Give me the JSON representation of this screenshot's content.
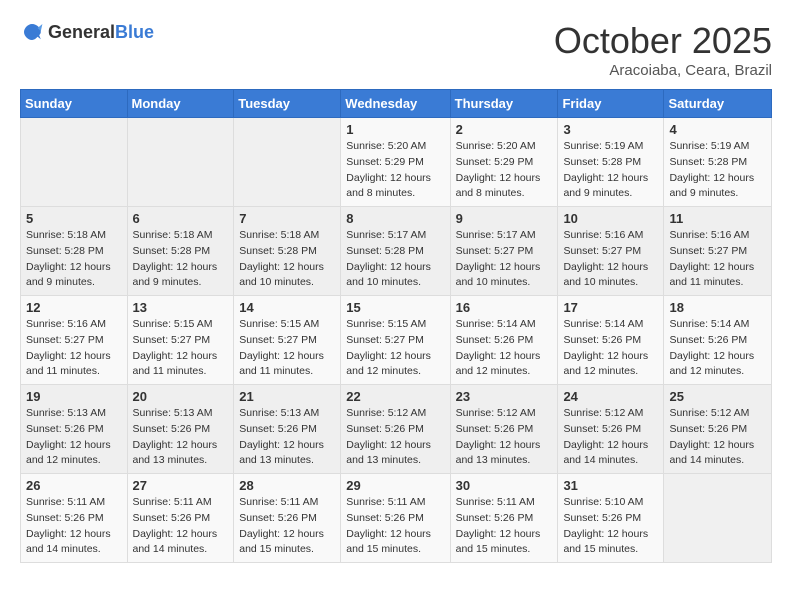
{
  "header": {
    "logo_general": "General",
    "logo_blue": "Blue",
    "month": "October 2025",
    "location": "Aracoiaba, Ceara, Brazil"
  },
  "weekdays": [
    "Sunday",
    "Monday",
    "Tuesday",
    "Wednesday",
    "Thursday",
    "Friday",
    "Saturday"
  ],
  "weeks": [
    [
      {
        "day": "",
        "sunrise": "",
        "sunset": "",
        "daylight": ""
      },
      {
        "day": "",
        "sunrise": "",
        "sunset": "",
        "daylight": ""
      },
      {
        "day": "",
        "sunrise": "",
        "sunset": "",
        "daylight": ""
      },
      {
        "day": "1",
        "sunrise": "Sunrise: 5:20 AM",
        "sunset": "Sunset: 5:29 PM",
        "daylight": "Daylight: 12 hours and 8 minutes."
      },
      {
        "day": "2",
        "sunrise": "Sunrise: 5:20 AM",
        "sunset": "Sunset: 5:29 PM",
        "daylight": "Daylight: 12 hours and 8 minutes."
      },
      {
        "day": "3",
        "sunrise": "Sunrise: 5:19 AM",
        "sunset": "Sunset: 5:28 PM",
        "daylight": "Daylight: 12 hours and 9 minutes."
      },
      {
        "day": "4",
        "sunrise": "Sunrise: 5:19 AM",
        "sunset": "Sunset: 5:28 PM",
        "daylight": "Daylight: 12 hours and 9 minutes."
      }
    ],
    [
      {
        "day": "5",
        "sunrise": "Sunrise: 5:18 AM",
        "sunset": "Sunset: 5:28 PM",
        "daylight": "Daylight: 12 hours and 9 minutes."
      },
      {
        "day": "6",
        "sunrise": "Sunrise: 5:18 AM",
        "sunset": "Sunset: 5:28 PM",
        "daylight": "Daylight: 12 hours and 9 minutes."
      },
      {
        "day": "7",
        "sunrise": "Sunrise: 5:18 AM",
        "sunset": "Sunset: 5:28 PM",
        "daylight": "Daylight: 12 hours and 10 minutes."
      },
      {
        "day": "8",
        "sunrise": "Sunrise: 5:17 AM",
        "sunset": "Sunset: 5:28 PM",
        "daylight": "Daylight: 12 hours and 10 minutes."
      },
      {
        "day": "9",
        "sunrise": "Sunrise: 5:17 AM",
        "sunset": "Sunset: 5:27 PM",
        "daylight": "Daylight: 12 hours and 10 minutes."
      },
      {
        "day": "10",
        "sunrise": "Sunrise: 5:16 AM",
        "sunset": "Sunset: 5:27 PM",
        "daylight": "Daylight: 12 hours and 10 minutes."
      },
      {
        "day": "11",
        "sunrise": "Sunrise: 5:16 AM",
        "sunset": "Sunset: 5:27 PM",
        "daylight": "Daylight: 12 hours and 11 minutes."
      }
    ],
    [
      {
        "day": "12",
        "sunrise": "Sunrise: 5:16 AM",
        "sunset": "Sunset: 5:27 PM",
        "daylight": "Daylight: 12 hours and 11 minutes."
      },
      {
        "day": "13",
        "sunrise": "Sunrise: 5:15 AM",
        "sunset": "Sunset: 5:27 PM",
        "daylight": "Daylight: 12 hours and 11 minutes."
      },
      {
        "day": "14",
        "sunrise": "Sunrise: 5:15 AM",
        "sunset": "Sunset: 5:27 PM",
        "daylight": "Daylight: 12 hours and 11 minutes."
      },
      {
        "day": "15",
        "sunrise": "Sunrise: 5:15 AM",
        "sunset": "Sunset: 5:27 PM",
        "daylight": "Daylight: 12 hours and 12 minutes."
      },
      {
        "day": "16",
        "sunrise": "Sunrise: 5:14 AM",
        "sunset": "Sunset: 5:26 PM",
        "daylight": "Daylight: 12 hours and 12 minutes."
      },
      {
        "day": "17",
        "sunrise": "Sunrise: 5:14 AM",
        "sunset": "Sunset: 5:26 PM",
        "daylight": "Daylight: 12 hours and 12 minutes."
      },
      {
        "day": "18",
        "sunrise": "Sunrise: 5:14 AM",
        "sunset": "Sunset: 5:26 PM",
        "daylight": "Daylight: 12 hours and 12 minutes."
      }
    ],
    [
      {
        "day": "19",
        "sunrise": "Sunrise: 5:13 AM",
        "sunset": "Sunset: 5:26 PM",
        "daylight": "Daylight: 12 hours and 12 minutes."
      },
      {
        "day": "20",
        "sunrise": "Sunrise: 5:13 AM",
        "sunset": "Sunset: 5:26 PM",
        "daylight": "Daylight: 12 hours and 13 minutes."
      },
      {
        "day": "21",
        "sunrise": "Sunrise: 5:13 AM",
        "sunset": "Sunset: 5:26 PM",
        "daylight": "Daylight: 12 hours and 13 minutes."
      },
      {
        "day": "22",
        "sunrise": "Sunrise: 5:12 AM",
        "sunset": "Sunset: 5:26 PM",
        "daylight": "Daylight: 12 hours and 13 minutes."
      },
      {
        "day": "23",
        "sunrise": "Sunrise: 5:12 AM",
        "sunset": "Sunset: 5:26 PM",
        "daylight": "Daylight: 12 hours and 13 minutes."
      },
      {
        "day": "24",
        "sunrise": "Sunrise: 5:12 AM",
        "sunset": "Sunset: 5:26 PM",
        "daylight": "Daylight: 12 hours and 14 minutes."
      },
      {
        "day": "25",
        "sunrise": "Sunrise: 5:12 AM",
        "sunset": "Sunset: 5:26 PM",
        "daylight": "Daylight: 12 hours and 14 minutes."
      }
    ],
    [
      {
        "day": "26",
        "sunrise": "Sunrise: 5:11 AM",
        "sunset": "Sunset: 5:26 PM",
        "daylight": "Daylight: 12 hours and 14 minutes."
      },
      {
        "day": "27",
        "sunrise": "Sunrise: 5:11 AM",
        "sunset": "Sunset: 5:26 PM",
        "daylight": "Daylight: 12 hours and 14 minutes."
      },
      {
        "day": "28",
        "sunrise": "Sunrise: 5:11 AM",
        "sunset": "Sunset: 5:26 PM",
        "daylight": "Daylight: 12 hours and 15 minutes."
      },
      {
        "day": "29",
        "sunrise": "Sunrise: 5:11 AM",
        "sunset": "Sunset: 5:26 PM",
        "daylight": "Daylight: 12 hours and 15 minutes."
      },
      {
        "day": "30",
        "sunrise": "Sunrise: 5:11 AM",
        "sunset": "Sunset: 5:26 PM",
        "daylight": "Daylight: 12 hours and 15 minutes."
      },
      {
        "day": "31",
        "sunrise": "Sunrise: 5:10 AM",
        "sunset": "Sunset: 5:26 PM",
        "daylight": "Daylight: 12 hours and 15 minutes."
      },
      {
        "day": "",
        "sunrise": "",
        "sunset": "",
        "daylight": ""
      }
    ]
  ]
}
